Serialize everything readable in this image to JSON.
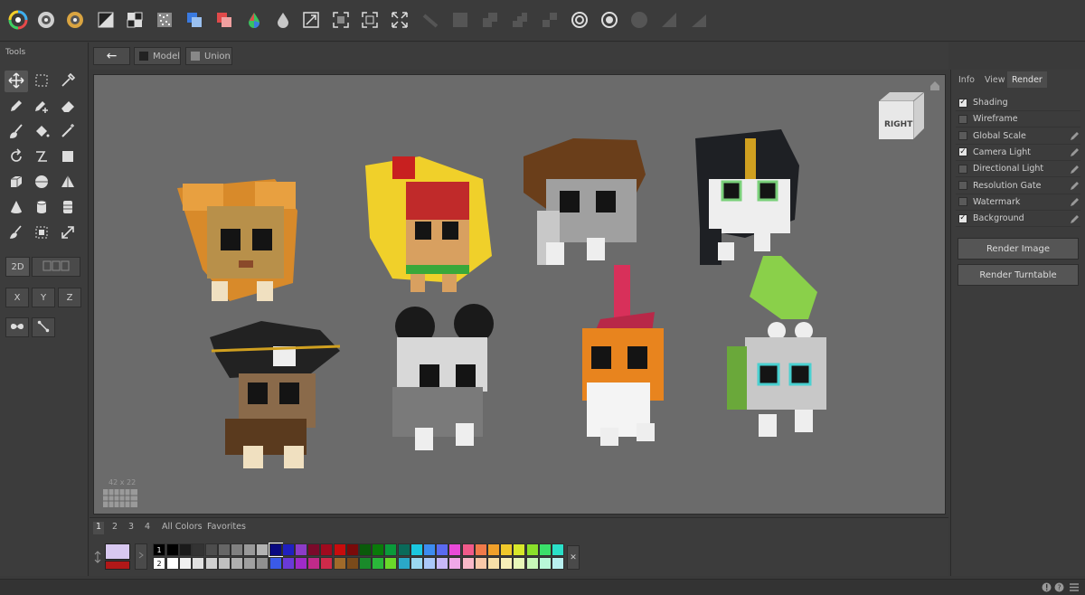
{
  "tools_panel": {
    "title": "Tools"
  },
  "subbar": {
    "back_label": "←",
    "model_label": "Model",
    "union_label": "Union"
  },
  "view_cube": {
    "face_label": "RIGHT"
  },
  "grid_readout": "42 x 22",
  "right_panel": {
    "tabs": [
      "Info",
      "View",
      "Render"
    ],
    "active_tab": "Render",
    "options": [
      {
        "label": "Shading",
        "checked": true,
        "editable": false
      },
      {
        "label": "Wireframe",
        "checked": false,
        "editable": false
      },
      {
        "label": "Global Scale",
        "checked": false,
        "editable": true
      },
      {
        "label": "Camera Light",
        "checked": true,
        "editable": true
      },
      {
        "label": "Directional Light",
        "checked": false,
        "editable": true
      },
      {
        "label": "Resolution Gate",
        "checked": false,
        "editable": true
      },
      {
        "label": "Watermark",
        "checked": false,
        "editable": true
      },
      {
        "label": "Background",
        "checked": true,
        "editable": true
      }
    ],
    "render_image_label": "Render Image",
    "render_turntable_label": "Render Turntable"
  },
  "tools": {
    "mode_2d": "2D",
    "axes": [
      "X",
      "Y",
      "Z"
    ]
  },
  "palette": {
    "tabs": [
      "1",
      "2",
      "3",
      "4",
      "All Colors",
      "Favorites"
    ],
    "active_tab": "1",
    "row_labels": [
      "1",
      "2"
    ],
    "primary_color": "#d8c8f0",
    "secondary_color": "#b01818",
    "close_label": "✕",
    "row1": [
      "#000000",
      "#1a1a1a",
      "#333333",
      "#4d4d4d",
      "#666666",
      "#808080",
      "#999999",
      "#b3b3b3",
      "#0a0a80",
      "#2020c0",
      "#8c3cc8",
      "#7a0a2a",
      "#a00a1e",
      "#c80c0c",
      "#7a0a0a",
      "#0a5a0a",
      "#0a7a0a",
      "#0a9a3a",
      "#0a6a5a",
      "#1ac8e0",
      "#3c8cf0",
      "#5a6af0",
      "#e84ad8",
      "#f05a8a",
      "#f07a4a",
      "#f0a02a",
      "#f0c82a",
      "#d8e82a",
      "#8ae02a",
      "#3ae06a",
      "#2ae0c8"
    ],
    "row2": [
      "#ffffff",
      "#f0f0f0",
      "#e0e0e0",
      "#d0d0d0",
      "#c0c0c0",
      "#b0b0b0",
      "#a0a0a0",
      "#909090",
      "#3a5ae8",
      "#6a3ad8",
      "#a02ac8",
      "#c02a8a",
      "#d02a4a",
      "#a06a2a",
      "#7a4a1a",
      "#1a8a2a",
      "#2ab83a",
      "#6ad82a",
      "#2aa8c8",
      "#9ad8f0",
      "#aac8f8",
      "#c8b8f8",
      "#f0a8e8",
      "#f8b8c8",
      "#f8c8a8",
      "#f8e0a8",
      "#f8f0b8",
      "#e8f8b8",
      "#c8f8b8",
      "#b8f8d8",
      "#b8f0f0"
    ]
  }
}
